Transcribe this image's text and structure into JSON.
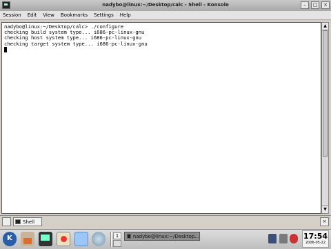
{
  "window": {
    "title": "nadybo@linux:~/Desktop/calc - Shell - Konsole"
  },
  "menu": [
    "Session",
    "Edit",
    "View",
    "Bookmarks",
    "Settings",
    "Help"
  ],
  "terminal": {
    "lines": [
      "nadybo@linux:~/Desktop/calc> ./configure",
      "checking build system type... i686-pc-linux-gnu",
      "checking host system type... i686-pc-linux-gnu",
      "checking target system type... i686-pc-linux-gnu"
    ]
  },
  "tabs": [
    {
      "label": "Shell"
    }
  ],
  "taskbar": {
    "desktop_number": "1",
    "task_label": "nadybo@linux:~/Desktop...",
    "clock_time": "17:54",
    "clock_date": "2006-05-22"
  },
  "icons": {
    "window": "konsole-icon",
    "panel": [
      "kmenu-icon",
      "home-icon",
      "konsole-icon",
      "help-icon",
      "mail-icon",
      "browser-icon"
    ],
    "tray": [
      "network-icon",
      "clipboard-icon",
      "update-icon"
    ]
  }
}
